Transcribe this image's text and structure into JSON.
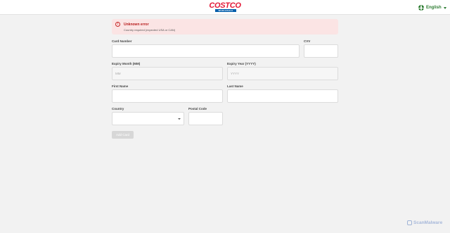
{
  "header": {
    "logo_text": "COSTCO",
    "logo_subtext": "WHOLESALE",
    "language_label": "English",
    "globe_icon": "globe-icon",
    "chevron_icon": "chevron-down-icon"
  },
  "alert": {
    "icon": "error-icon",
    "title": "Unknown error",
    "message": "Country required (expected USA or CAN)"
  },
  "form": {
    "card_number": {
      "label": "Card Number",
      "value": ""
    },
    "cvv": {
      "label": "CVV",
      "value": ""
    },
    "expiry_month": {
      "label": "Expiry Month (MM)",
      "placeholder": "MM"
    },
    "expiry_year": {
      "label": "Expiry Year (YYYY)",
      "placeholder": "YYYY"
    },
    "first_name": {
      "label": "First Name",
      "value": ""
    },
    "last_name": {
      "label": "Last Name",
      "value": ""
    },
    "country": {
      "label": "Country",
      "value": ""
    },
    "postal_code": {
      "label": "Postal Code",
      "value": ""
    },
    "submit_label": "Add Card"
  },
  "watermark": {
    "text": "ScanMalware"
  },
  "colors": {
    "brand_red": "#e31837",
    "brand_blue": "#005daa",
    "language_green": "#2e7d32",
    "alert_bg": "#fbe4e4",
    "alert_text": "#b71c1c"
  }
}
